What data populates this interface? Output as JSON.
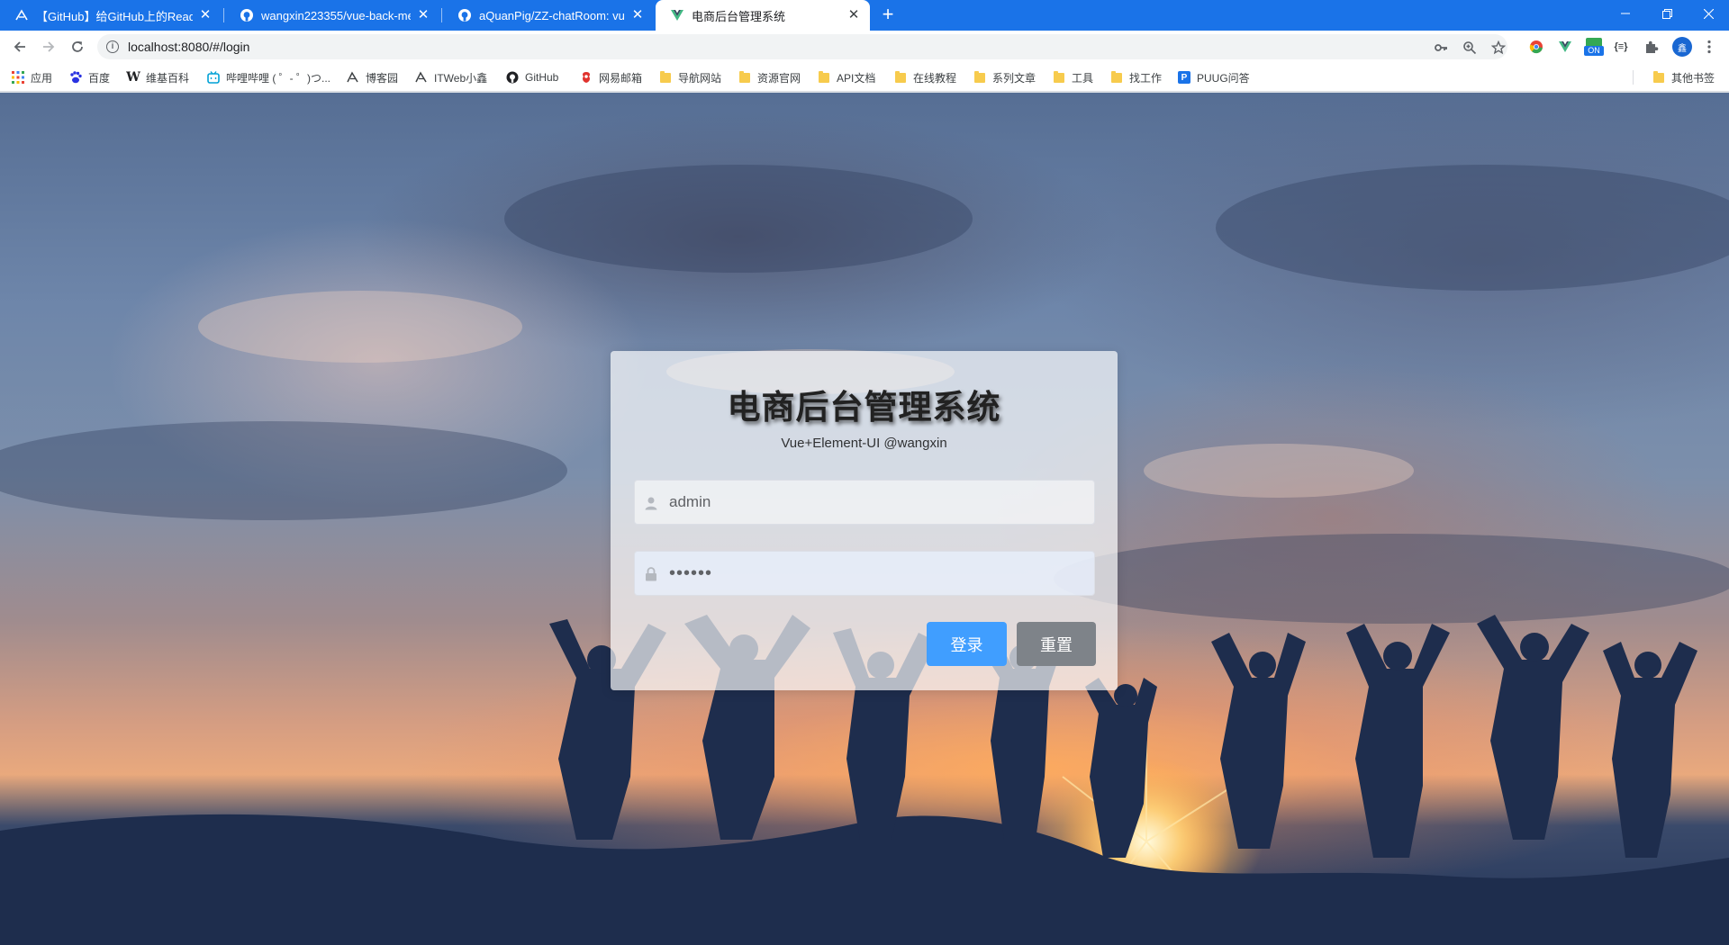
{
  "browser": {
    "tabs": [
      {
        "title": "【GitHub】给GitHub上的ReadMe"
      },
      {
        "title": "wangxin223355/vue-back-me"
      },
      {
        "title": "aQuanPig/ZZ-chatRoom: vue+"
      },
      {
        "title": "电商后台管理系统"
      }
    ],
    "new_tab_symbol": "+",
    "url": "localhost:8080/#/login",
    "extension_badge": "ON"
  },
  "bookmarks": [
    {
      "label": "应用",
      "icon": "apps-grid-icon"
    },
    {
      "label": "百度",
      "icon": "baidu-paw-icon"
    },
    {
      "label": "维基百科",
      "icon": "wikipedia-w-icon"
    },
    {
      "label": "哔哩哔哩 ( ゜- ゜)つ...",
      "icon": "bilibili-tv-icon"
    },
    {
      "label": "博客园",
      "icon": "cnblogs-icon"
    },
    {
      "label": "ITWeb小鑫",
      "icon": "cnblogs-icon"
    },
    {
      "label": "GitHub",
      "icon": "github-icon"
    },
    {
      "label": "网易邮箱",
      "icon": "netease-mail-icon"
    },
    {
      "label": "导航网站",
      "icon": "folder-icon"
    },
    {
      "label": "资源官网",
      "icon": "folder-icon"
    },
    {
      "label": "API文档",
      "icon": "folder-icon"
    },
    {
      "label": "在线教程",
      "icon": "folder-icon"
    },
    {
      "label": "系列文章",
      "icon": "folder-icon"
    },
    {
      "label": "工具",
      "icon": "folder-icon"
    },
    {
      "label": "找工作",
      "icon": "folder-icon"
    },
    {
      "label": "PUUG问答",
      "icon": "puug-icon"
    }
  ],
  "other_bookmarks": "其他书签",
  "login": {
    "title": "电商后台管理系统",
    "subtitle": "Vue+Element-UI @wangxin",
    "username_value": "admin",
    "password_value": "••••••",
    "login_button": "登录",
    "reset_button": "重置"
  },
  "colors": {
    "chrome_blue": "#1a73e8",
    "primary_button": "#409eff",
    "reset_button": "#7e8389"
  }
}
